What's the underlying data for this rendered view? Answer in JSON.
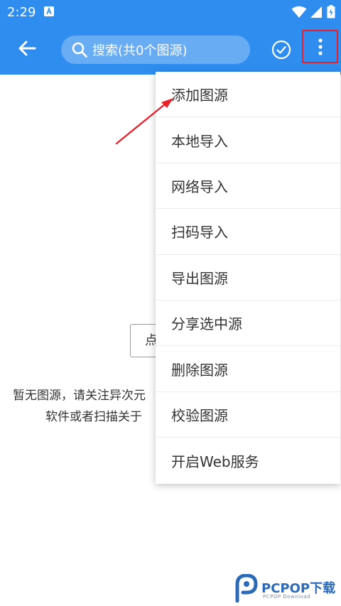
{
  "status_bar": {
    "time": "2:29"
  },
  "toolbar": {
    "search_placeholder": "搜索(共0个图源)"
  },
  "main": {
    "import_button_label": "点",
    "empty_line1": "暂无图源，请关注异次元",
    "empty_line2": "软件或者扫描关于"
  },
  "menu": {
    "items": [
      {
        "label": "添加图源"
      },
      {
        "label": "本地导入"
      },
      {
        "label": "网络导入"
      },
      {
        "label": "扫码导入"
      },
      {
        "label": "导出图源"
      },
      {
        "label": "分享选中源"
      },
      {
        "label": "删除图源"
      },
      {
        "label": "校验图源"
      },
      {
        "label": "开启Web服务"
      }
    ]
  },
  "watermark": {
    "brand": "PCPOP下载",
    "sub": "PCPOP Download"
  },
  "colors": {
    "header": "#2f8df0",
    "highlight_box": "#e8202a",
    "arrow": "#e8202a"
  },
  "icons": [
    "back-arrow-icon",
    "search-icon",
    "check-circle-icon",
    "more-vert-icon",
    "wifi-icon",
    "signal-icon",
    "battery-icon"
  ]
}
